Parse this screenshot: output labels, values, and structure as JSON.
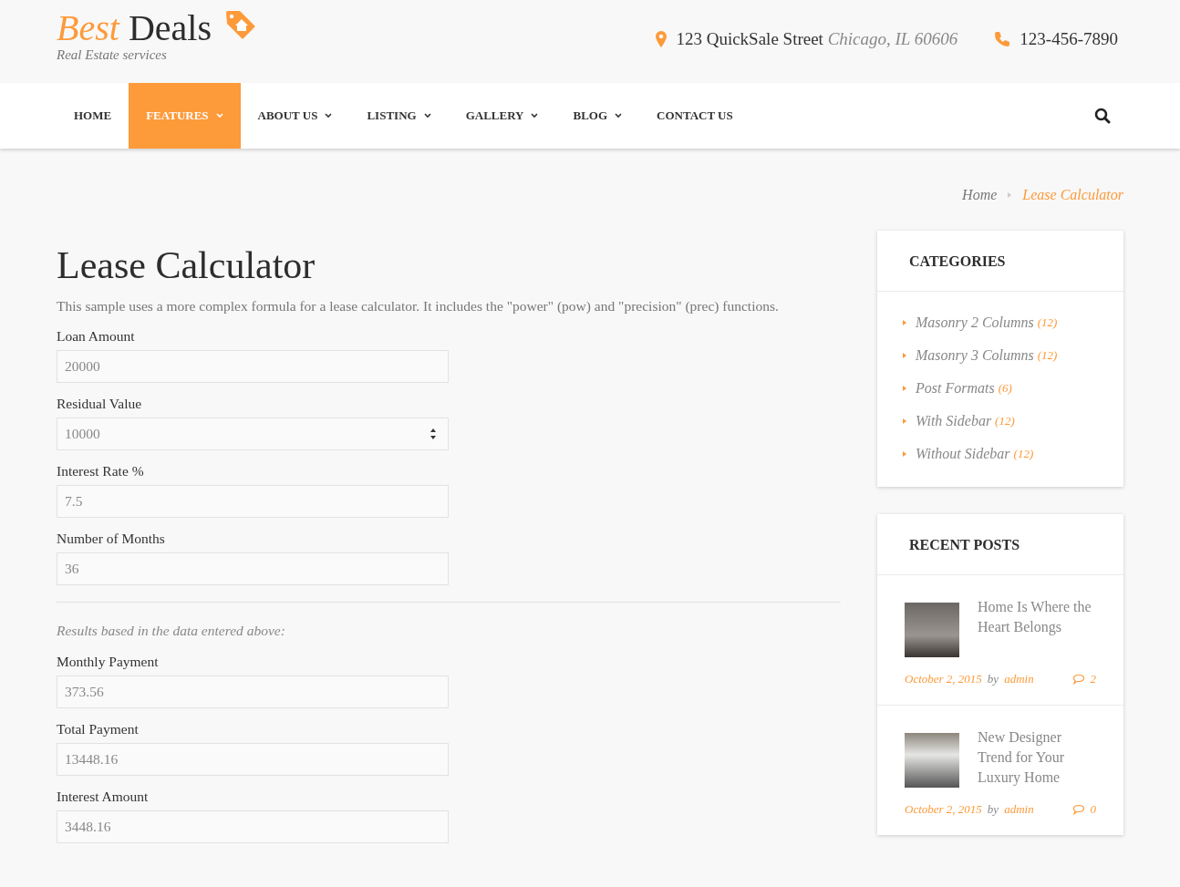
{
  "header": {
    "logo": {
      "accent": "Best",
      "word": "Deals",
      "tagline": "Real Estate services"
    },
    "address": {
      "street": "123 QuickSale Street",
      "city": "Chicago, IL 60606"
    },
    "phone": "123-456-7890"
  },
  "nav": {
    "items": [
      {
        "label": "HOME",
        "dropdown": false,
        "selected": false
      },
      {
        "label": "FEATURES",
        "dropdown": true,
        "selected": true
      },
      {
        "label": "ABOUT US",
        "dropdown": true,
        "selected": false
      },
      {
        "label": "LISTING",
        "dropdown": true,
        "selected": false
      },
      {
        "label": "GALLERY",
        "dropdown": true,
        "selected": false
      },
      {
        "label": "BLOG",
        "dropdown": true,
        "selected": false
      },
      {
        "label": "CONTACT US",
        "dropdown": false,
        "selected": false
      }
    ]
  },
  "breadcrumb": [
    {
      "label": "Home",
      "current": false
    },
    {
      "label": "Lease Calculator",
      "current": true
    }
  ],
  "page": {
    "title": "Lease Calculator",
    "intro": "This sample uses a more complex formula for a lease calculator. It includes the \"power\" (pow) and \"precision\" (prec) functions.",
    "fields": [
      {
        "label": "Loan Amount",
        "value": "20000",
        "kind": "text"
      },
      {
        "label": "Residual Value",
        "value": "10000",
        "kind": "number"
      },
      {
        "label": "Interest Rate %",
        "value": "7.5",
        "kind": "text"
      },
      {
        "label": "Number of Months",
        "value": "36",
        "kind": "text"
      }
    ],
    "results_note": "Results based in the data entered above:",
    "results": [
      {
        "label": "Monthly Payment",
        "value": "373.56"
      },
      {
        "label": "Total Payment",
        "value": "13448.16"
      },
      {
        "label": "Interest Amount",
        "value": "3448.16"
      }
    ]
  },
  "sidebar": {
    "categories": {
      "title": "CATEGORIES",
      "items": [
        {
          "label": "Masonry 2 Columns",
          "count": "(12)"
        },
        {
          "label": "Masonry 3 Columns",
          "count": "(12)"
        },
        {
          "label": "Post Formats",
          "count": "(6)"
        },
        {
          "label": "With Sidebar",
          "count": "(12)"
        },
        {
          "label": "Without Sidebar",
          "count": "(12)"
        }
      ]
    },
    "recent_posts": {
      "title": "RECENT POSTS",
      "posts": [
        {
          "title": "Home Is Where the Heart Belongs",
          "date": "October 2, 2015",
          "by": "by",
          "author": "admin",
          "comments": "2"
        },
        {
          "title": "New Designer Trend for Your Luxury Home",
          "date": "October 2, 2015",
          "by": "by",
          "author": "admin",
          "comments": "0"
        }
      ]
    }
  }
}
